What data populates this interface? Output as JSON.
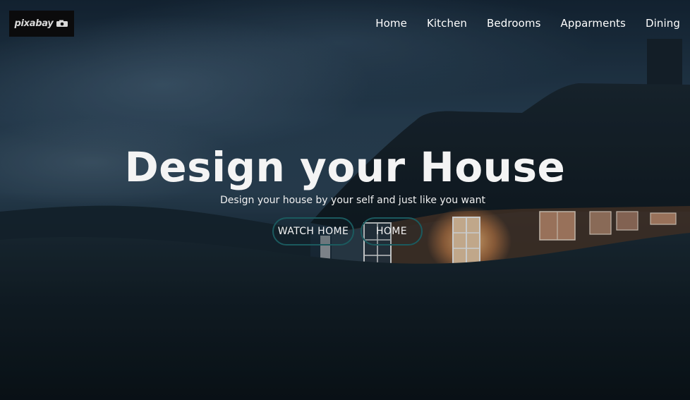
{
  "logo": {
    "text": "pixabay"
  },
  "nav": {
    "items": [
      "Home",
      "Kitchen",
      "Bedrooms",
      "Apparments",
      "Dining"
    ]
  },
  "hero": {
    "title": "Design your House",
    "subtitle": "Design your house by your self and just like you want",
    "buttons": {
      "watch_label": "WATCH HOME",
      "home_label": "HOME"
    }
  },
  "colors": {
    "button_border": "#1b5a5e",
    "window_light": "#ffb26a",
    "sky": "#2c4356",
    "ground": "#0f1a22"
  }
}
